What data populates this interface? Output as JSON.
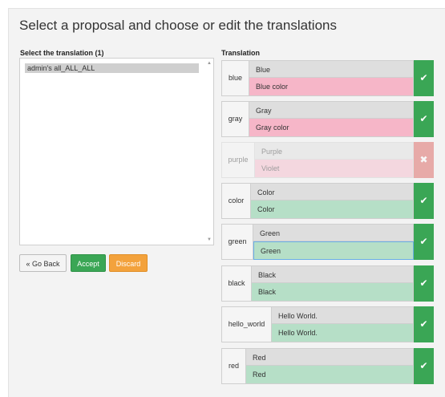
{
  "title": "Select a proposal and choose or edit the translations",
  "left": {
    "label": "Select the translation (1)",
    "options": [
      "admin's all_ALL_ALL"
    ],
    "scroll_up_icon": "▲",
    "scroll_down_icon": "▼"
  },
  "buttons": {
    "back": "« Go Back",
    "accept": "Accept",
    "discard": "Discard"
  },
  "translation": {
    "label": "Translation",
    "rows": [
      {
        "key": "blue",
        "source": "Blue",
        "value": "Blue color",
        "status": "accepted",
        "value_color": "pink",
        "icon": "✔"
      },
      {
        "key": "gray",
        "source": "Gray",
        "value": "Gray color",
        "status": "accepted",
        "value_color": "pink",
        "icon": "✔"
      },
      {
        "key": "purple",
        "source": "Purple",
        "value": "Violet",
        "status": "rejected",
        "value_color": "pink",
        "icon": "✖"
      },
      {
        "key": "color",
        "source": "Color",
        "value": "Color",
        "status": "accepted",
        "value_color": "green",
        "icon": "✔"
      },
      {
        "key": "green",
        "source": "Green",
        "value": "Green",
        "status": "accepted",
        "value_color": "green",
        "editing": true,
        "icon": "✔"
      },
      {
        "key": "black",
        "source": "Black",
        "value": "Black",
        "status": "accepted",
        "value_color": "green",
        "icon": "✔"
      },
      {
        "key": "hello_world",
        "source": "Hello World.",
        "value": "Hello World.",
        "status": "accepted",
        "value_color": "green",
        "icon": "✔"
      },
      {
        "key": "red",
        "source": "Red",
        "value": "Red",
        "status": "accepted",
        "value_color": "green",
        "icon": "✔"
      }
    ]
  },
  "colors": {
    "accept": "#3aa655",
    "discard": "#f3a23c",
    "reject": "#d9534f",
    "pink": "#f6b6c8",
    "green": "#b6dfc7"
  }
}
